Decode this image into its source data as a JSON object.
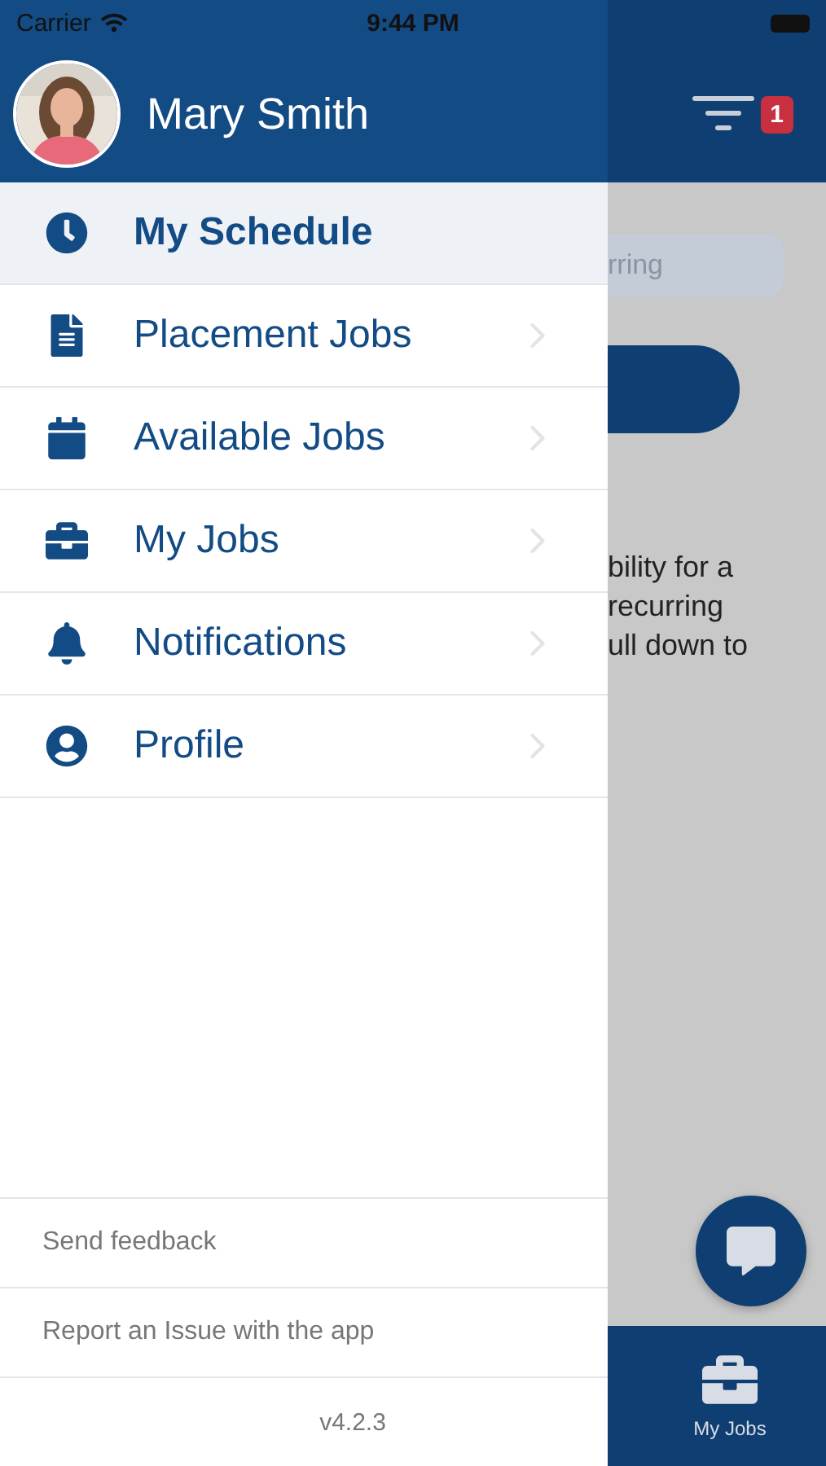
{
  "status_bar": {
    "carrier": "Carrier",
    "time": "9:44 PM"
  },
  "drawer": {
    "user_name": "Mary Smith",
    "items": [
      {
        "label": "My Schedule",
        "kind": "clock",
        "selected": true
      },
      {
        "label": "Placement Jobs",
        "kind": "document",
        "selected": false
      },
      {
        "label": "Available Jobs",
        "kind": "calendar",
        "selected": false
      },
      {
        "label": "My Jobs",
        "kind": "briefcase",
        "selected": false
      },
      {
        "label": "Notifications",
        "kind": "bell",
        "selected": false
      },
      {
        "label": "Profile",
        "kind": "user",
        "selected": false
      }
    ],
    "footer_links": [
      "Send feedback",
      "Report an Issue with the app"
    ],
    "version": "v4.2.3"
  },
  "background": {
    "filter_badge": "1",
    "search_placeholder": "rring",
    "paragraph_lines": [
      "bility for a",
      "recurring",
      "ull down to"
    ],
    "tab_label": "My Jobs"
  }
}
